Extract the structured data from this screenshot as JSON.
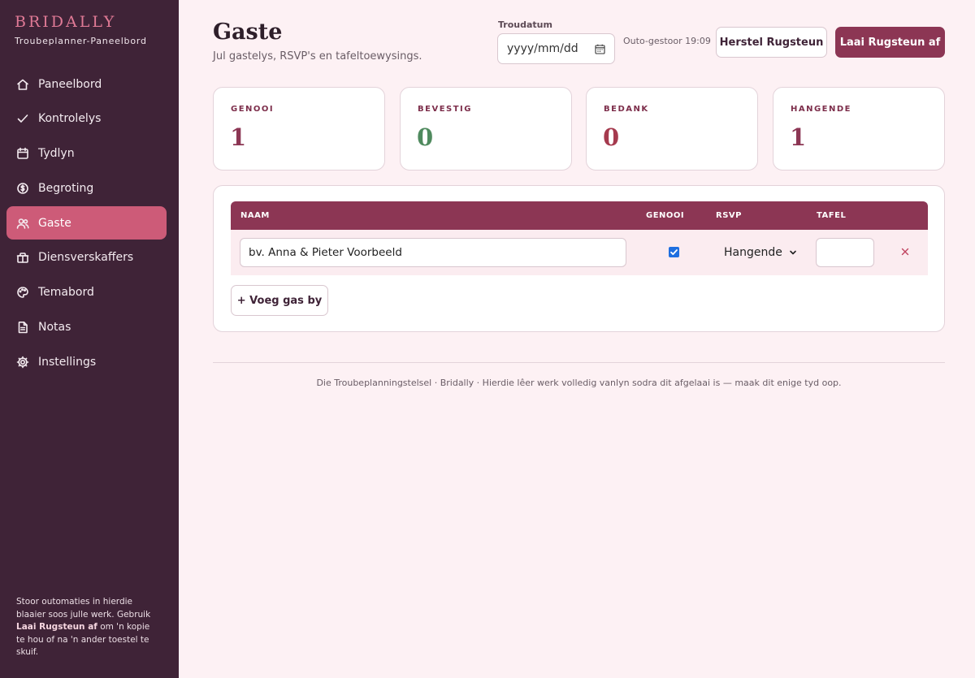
{
  "sidebar": {
    "brand": "BRIDALLY",
    "subtitle": "Troubeplanner-Paneelbord",
    "items": [
      {
        "label": "Paneelbord",
        "icon": "home-icon"
      },
      {
        "label": "Kontrolelys",
        "icon": "check-icon"
      },
      {
        "label": "Tydlyn",
        "icon": "calendar-icon"
      },
      {
        "label": "Begroting",
        "icon": "coin-icon"
      },
      {
        "label": "Gaste",
        "icon": "users-icon",
        "active": true
      },
      {
        "label": "Diensverskaffers",
        "icon": "gift-icon"
      },
      {
        "label": "Temabord",
        "icon": "palette-icon"
      },
      {
        "label": "Notas",
        "icon": "document-icon"
      },
      {
        "label": "Instellings",
        "icon": "gear-icon"
      }
    ],
    "note": {
      "line1": "Stoor outomaties in hierdie blaaier soos julle werk.",
      "prefix": "Gebruik",
      "bold": "Laai Rugsteun af",
      "suffix": "om 'n kopie te hou of na 'n ander toestel te skuif."
    }
  },
  "header": {
    "title": "Gaste",
    "subtitle": "Jul gastelys, RSVP's en tafeltoewysings.",
    "date_label": "Troudatum",
    "date_placeholder": "yyyy/mm/dd",
    "autosave": "Outo-gestoor 19:09",
    "restore_label": "Herstel Rugsteun",
    "download_label": "Laai Rugsteun af"
  },
  "stats": [
    {
      "label": "GENOOI",
      "value": "1",
      "color": "#8c3654"
    },
    {
      "label": "BEVESTIG",
      "value": "0",
      "color": "#4f8a5e"
    },
    {
      "label": "BEDANK",
      "value": "0",
      "color": "#a53a4e"
    },
    {
      "label": "HANGENDE",
      "value": "1",
      "color": "#8c3654"
    }
  ],
  "guests": {
    "columns": [
      "NAAM",
      "GENOOI",
      "RSVP",
      "TAFEL"
    ],
    "rows": [
      {
        "name_placeholder": "bv. Anna & Pieter Voorbeeld",
        "invited": true,
        "rsvp": "Hangende",
        "table": ""
      }
    ],
    "add_label": "+ Voeg gas by"
  },
  "footer": "Die Troubeplanningstelsel · Bridally · Hierdie lêer werk volledig vanlyn sodra dit afgelaai is — maak dit enige tyd oop.",
  "colors": {
    "sidebar_bg": "#3f2337",
    "accent": "#8c3654",
    "active_nav": "#cd5b78",
    "page_bg": "#fdf1f4"
  }
}
